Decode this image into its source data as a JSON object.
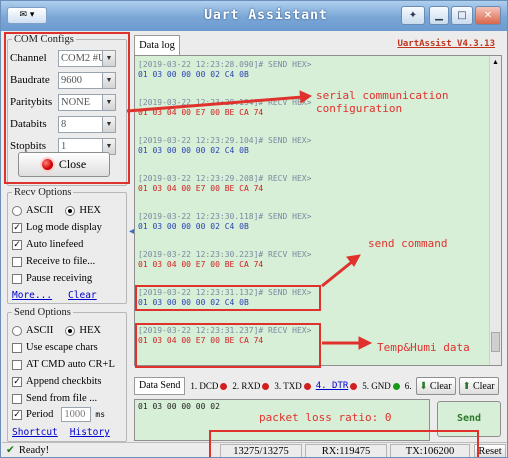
{
  "window": {
    "title": "Uart Assistant",
    "sysmenu_icon": "app-menu-icon",
    "controls": [
      "pin",
      "minimize",
      "maximize",
      "close"
    ]
  },
  "com_configs": {
    "legend": "COM Configs",
    "fields": [
      {
        "label": "Channel",
        "value": "COM2 #U"
      },
      {
        "label": "Baudrate",
        "value": "9600"
      },
      {
        "label": "Paritybits",
        "value": "NONE"
      },
      {
        "label": "Databits",
        "value": "8"
      },
      {
        "label": "Stopbits",
        "value": "1"
      }
    ],
    "close_label": "Close"
  },
  "recv_options": {
    "legend": "Recv Options",
    "ascii": "ASCII",
    "hex": "HEX",
    "selected": "HEX",
    "checks": [
      {
        "label": "Log mode display",
        "checked": true
      },
      {
        "label": "Auto linefeed",
        "checked": true
      },
      {
        "label": "Receive to file...",
        "checked": false
      },
      {
        "label": "Pause receiving",
        "checked": false
      }
    ],
    "more": "More...",
    "clear": "Clear"
  },
  "send_options": {
    "legend": "Send Options",
    "ascii": "ASCII",
    "hex": "HEX",
    "selected": "HEX",
    "checks": [
      {
        "label": "Use escape chars",
        "checked": false
      },
      {
        "label": "AT CMD auto CR+L",
        "checked": false
      },
      {
        "label": "Append checkbits",
        "checked": true
      },
      {
        "label": "Send from file ...",
        "checked": false
      }
    ],
    "period_label": "Period",
    "period_value": "1000",
    "period_unit": "ms",
    "shortcut": "Shortcut",
    "history": "History"
  },
  "log": {
    "tab": "Data log",
    "version": "UartAssist V4.3.13",
    "entries": [
      {
        "head": "[2019-03-22 12:23:28.090]# SEND HEX>",
        "data": "01 03 00 00 00 02 C4 0B",
        "kind": "send"
      },
      {
        "head": "[2019-03-22 12:23:28.194]# RECV HEX>",
        "data": "01 03 04 00 E7 00 BE CA 74",
        "kind": "recv"
      },
      {
        "head": "[2019-03-22 12:23:29.104]# SEND HEX>",
        "data": "01 03 00 00 00 02 C4 0B",
        "kind": "send"
      },
      {
        "head": "[2019-03-22 12:23:29.208]# RECV HEX>",
        "data": "01 03 04 00 E7 00 BE CA 74",
        "kind": "recv"
      },
      {
        "head": "[2019-03-22 12:23:30.118]# SEND HEX>",
        "data": "01 03 00 00 00 02 C4 0B",
        "kind": "send"
      },
      {
        "head": "[2019-03-22 12:23:30.223]# RECV HEX>",
        "data": "01 03 04 00 E7 00 BE CA 74",
        "kind": "recv"
      },
      {
        "head": "[2019-03-22 12:23:31.132]# SEND HEX>",
        "data": "01 03 00 00 00 02 C4 0B",
        "kind": "send"
      },
      {
        "head": "[2019-03-22 12:23:31.237]# RECV HEX>",
        "data": "01 03 04 00 E7 00 BE CA 74",
        "kind": "recv"
      }
    ]
  },
  "annotations": {
    "serial": "serial communication",
    "serial2": "configuration",
    "send_cmd": "send command",
    "temp": "Temp&Humi data",
    "loss": "packet loss ratio: 0"
  },
  "send_bar": {
    "tab": "Data Send",
    "pins": [
      {
        "label": "1. DCD",
        "color": "#d21f1f"
      },
      {
        "label": "2. RXD",
        "color": "#d21f1f"
      },
      {
        "label": "3. TXD",
        "color": "#d21f1f"
      },
      {
        "label": "4. DTR",
        "color": "#d21f1f"
      },
      {
        "label": "5. GND",
        "color": "#1a9a1a"
      },
      {
        "label": "6.",
        "color": ""
      }
    ],
    "clear1": "Clear",
    "clear2": "Clear",
    "input": "01 03 00 00 00 02",
    "send": "Send"
  },
  "status": {
    "ready": "Ready!",
    "count": "13275/13275",
    "rx": "RX:119475",
    "tx": "TX:106200",
    "reset": "Reset"
  },
  "colors": {
    "accent": "#e0322d",
    "log_bg": "#d7eed7"
  }
}
